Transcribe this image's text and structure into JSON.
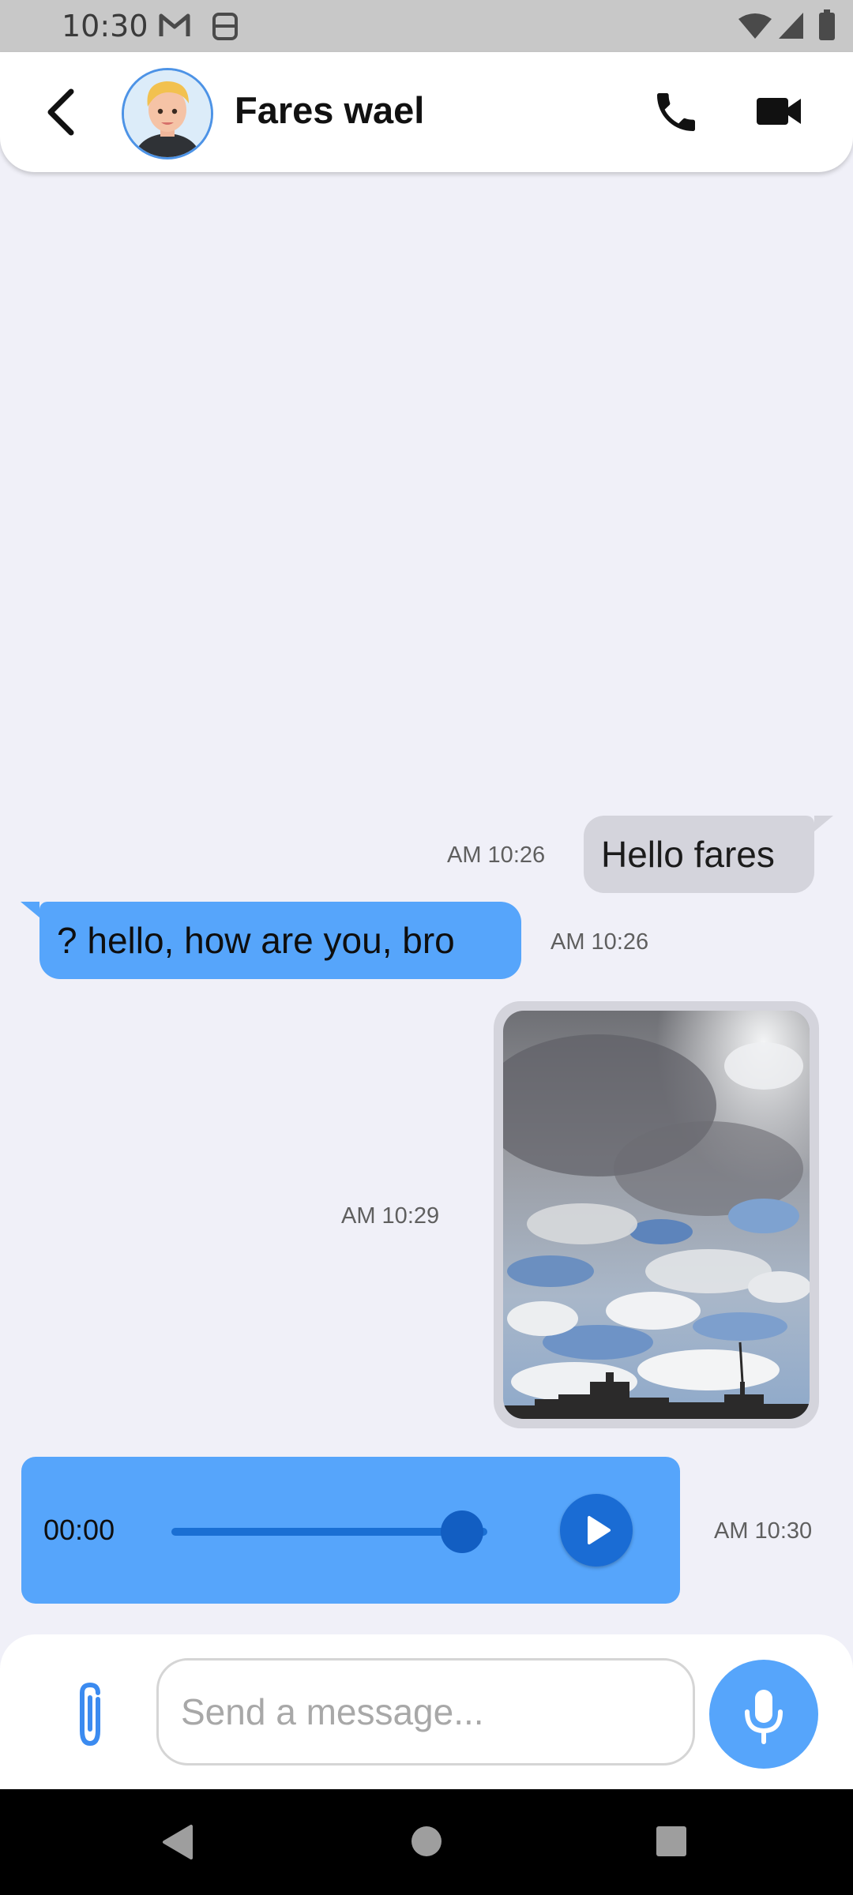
{
  "status_bar": {
    "time": "10:30",
    "left_icons": [
      "gmail-icon",
      "calendar-strike-icon"
    ],
    "right_icons": [
      "wifi-icon",
      "signal-icon",
      "battery-icon"
    ]
  },
  "header": {
    "contact_name": "Fares wael",
    "icons": [
      "back-arrow-icon",
      "avatar",
      "phone-icon",
      "video-camera-icon"
    ]
  },
  "messages": [
    {
      "direction": "outgoing",
      "type": "text",
      "text": "Hello fares",
      "time": "AM 10:26"
    },
    {
      "direction": "incoming",
      "type": "text",
      "text": "? hello, how are you, bro",
      "time": "AM 10:26"
    },
    {
      "direction": "outgoing",
      "type": "image",
      "image": "cloudy-sky-photo",
      "time": "AM 10:29"
    },
    {
      "direction": "incoming",
      "type": "voice",
      "duration": "00:00",
      "progress": 0.92,
      "time": "AM 10:30"
    }
  ],
  "input": {
    "placeholder": "Send a message...",
    "value": ""
  },
  "colors": {
    "accent": "#56a5fb",
    "accent_dark": "#1a6cd4",
    "outgoing_bubble": "#d4d4dc",
    "chat_background": "#f0f0f8",
    "avatar_ring": "#4d93e6"
  }
}
